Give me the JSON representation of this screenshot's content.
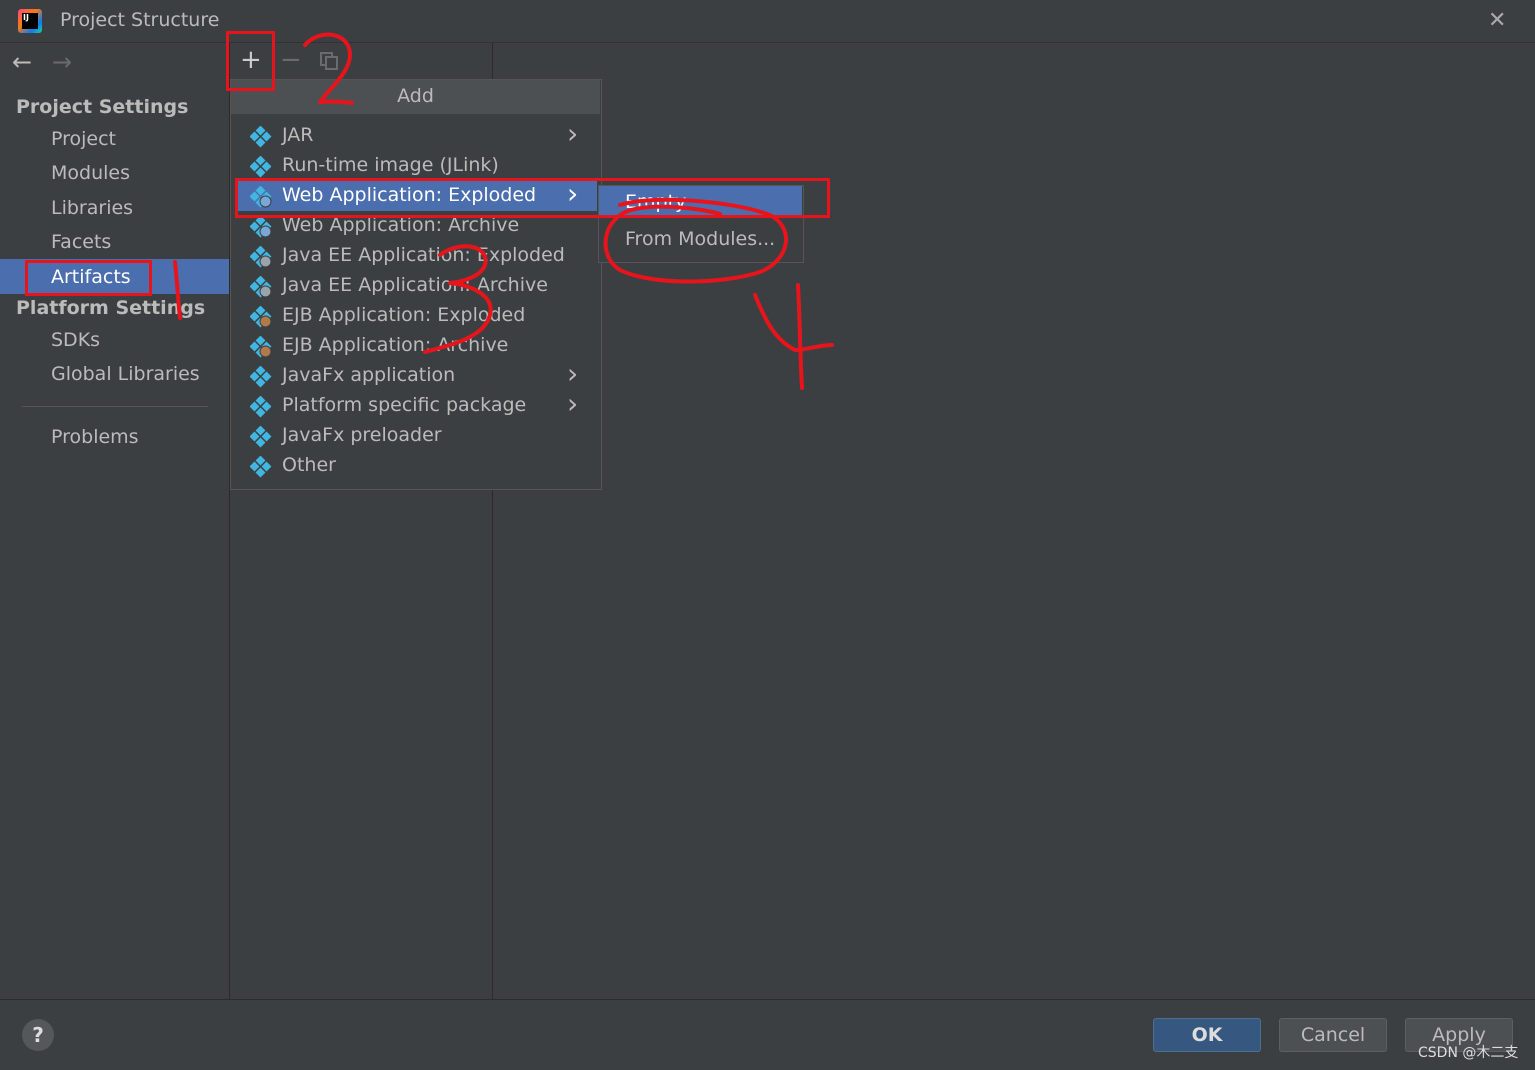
{
  "window": {
    "title": "Project Structure"
  },
  "sidebar": {
    "project_settings_header": "Project Settings",
    "project_items": [
      "Project",
      "Modules",
      "Libraries",
      "Facets",
      "Artifacts"
    ],
    "selected_item": "Artifacts",
    "platform_settings_header": "Platform Settings",
    "platform_items": [
      "SDKs",
      "Global Libraries"
    ],
    "problems": "Problems"
  },
  "add_popup": {
    "title": "Add",
    "items": [
      {
        "label": "JAR",
        "has_submenu": true,
        "icon": "artifact-icon"
      },
      {
        "label": "Run-time image (JLink)",
        "has_submenu": false,
        "icon": "artifact-icon"
      },
      {
        "label": "Web Application: Exploded",
        "has_submenu": true,
        "icon": "web-artifact-icon",
        "selected": true
      },
      {
        "label": "Web Application: Archive",
        "has_submenu": false,
        "icon": "web-artifact-icon"
      },
      {
        "label": "Java EE Application: Exploded",
        "has_submenu": false,
        "icon": "javaee-artifact-icon"
      },
      {
        "label": "Java EE Application: Archive",
        "has_submenu": false,
        "icon": "javaee-artifact-icon"
      },
      {
        "label": "EJB Application: Exploded",
        "has_submenu": false,
        "icon": "ejb-artifact-icon"
      },
      {
        "label": "EJB Application: Archive",
        "has_submenu": false,
        "icon": "ejb-artifact-icon"
      },
      {
        "label": "JavaFx application",
        "has_submenu": true,
        "icon": "artifact-icon"
      },
      {
        "label": "Platform specific package",
        "has_submenu": true,
        "icon": "artifact-icon"
      },
      {
        "label": "JavaFx preloader",
        "has_submenu": false,
        "icon": "artifact-icon"
      },
      {
        "label": "Other",
        "has_submenu": false,
        "icon": "artifact-icon"
      }
    ]
  },
  "submenu": {
    "items": [
      "Empty",
      "From Modules..."
    ],
    "selected": "Empty"
  },
  "footer": {
    "help": "?",
    "ok": "OK",
    "cancel": "Cancel",
    "apply": "Apply"
  },
  "watermark": "CSDN @木二支",
  "annotations": {
    "color": "#e8141c",
    "labels": [
      "1",
      "2",
      "3",
      "4"
    ]
  },
  "colors": {
    "selection": "#4b6eaf",
    "background": "#3c3f41",
    "ok_button": "#365880"
  }
}
